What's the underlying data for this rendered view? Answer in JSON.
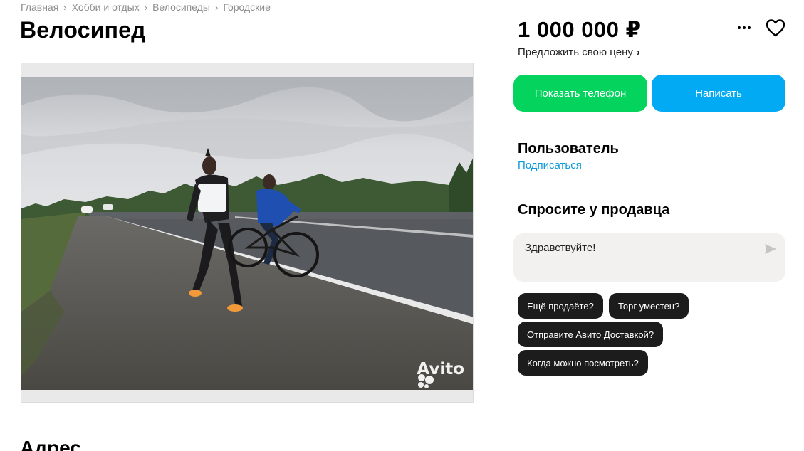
{
  "breadcrumb": [
    {
      "label": "Главная"
    },
    {
      "label": "Хобби и отдых"
    },
    {
      "label": "Велосипеды"
    },
    {
      "label": "Городские"
    }
  ],
  "listing": {
    "title": "Велосипед",
    "price": "1 000 000 ₽",
    "offer_price_label": "Предложить свою цену",
    "watermark": "Avito",
    "photo_description": "two men on a roadside, one running, one riding a bicycle"
  },
  "actions": {
    "show_phone": "Показать телефон",
    "write": "Написать"
  },
  "seller": {
    "name": "Пользователь",
    "subscribe": "Подписаться"
  },
  "ask": {
    "heading": "Спросите у продавца",
    "message": "Здравствуйте!",
    "quick_replies": [
      "Ещё продаёте?",
      "Торг уместен?",
      "Отправите Авито Доставкой?",
      "Когда можно посмотреть?"
    ]
  },
  "address": {
    "heading": "Адрес"
  },
  "colors": {
    "phone_button": "#04d35e",
    "write_button": "#02aaf4",
    "link": "#0a9ad9",
    "chip": "#1c1c1c"
  },
  "icons": [
    "chevron-right-icon",
    "more-dots-icon",
    "heart-icon",
    "send-icon",
    "avito-logo-icon"
  ]
}
